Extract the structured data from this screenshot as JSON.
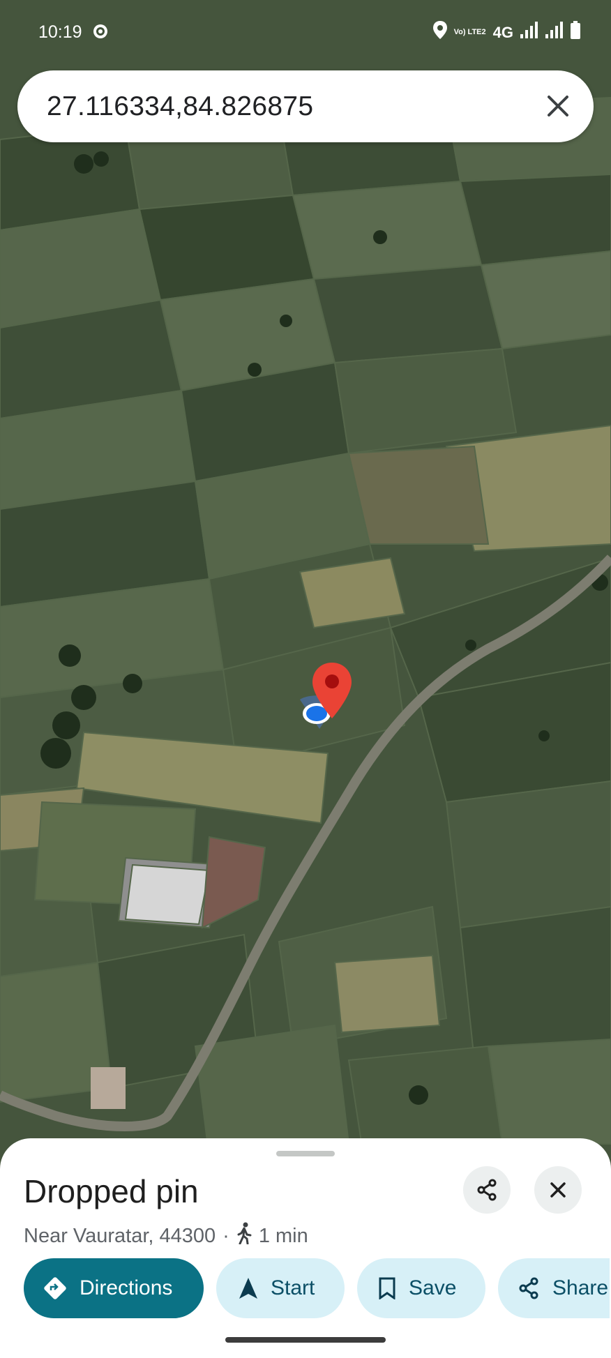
{
  "status_bar": {
    "time": "10:19",
    "volte": "Vo) LTE2",
    "network": "4G"
  },
  "search": {
    "query": "27.116334,84.826875"
  },
  "place": {
    "title": "Dropped pin",
    "near": "Near Vauratar, 44300",
    "separator": "·",
    "walk_time": "1 min"
  },
  "actions": {
    "directions": "Directions",
    "start": "Start",
    "save": "Save",
    "share": "Share"
  },
  "icons": {
    "share": "share-icon",
    "close": "close-icon",
    "walk": "walking-icon",
    "directions": "directions-icon",
    "start": "navigation-arrow-icon",
    "save": "bookmark-icon"
  },
  "colors": {
    "primary_chip": "#0b7285",
    "secondary_chip": "#d7f0f7",
    "pin": "#ea4335",
    "location": "#1a73e8"
  }
}
